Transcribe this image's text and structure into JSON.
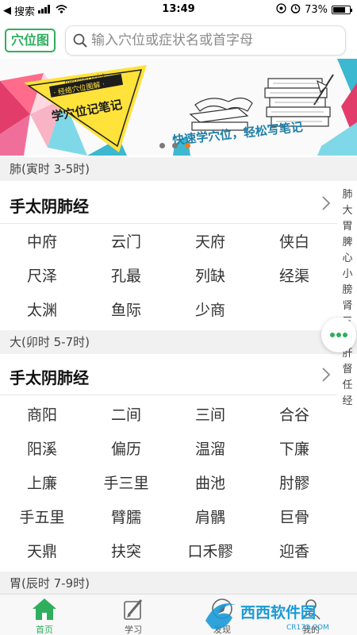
{
  "status_bar": {
    "carrier": "搜索",
    "time": "13:49",
    "battery": "73%"
  },
  "header": {
    "logo_text": "穴位图",
    "search_placeholder": "输入穴位或症状名或首字母"
  },
  "banner": {
    "badge_top": "meridian point",
    "badge_mid": "· 经络穴位图解 ·",
    "badge_title": "学穴位记笔记",
    "slogan": "快速学穴位，轻松写笔记",
    "page_count": 3,
    "active_page": 3,
    "accent_color": "#f0781e"
  },
  "sections": [
    {
      "header": "肺(寅时 3-5时)",
      "meridian": "手太阴肺经",
      "points": [
        "中府",
        "云门",
        "天府",
        "侠白",
        "尺泽",
        "孔最",
        "列缺",
        "经渠",
        "太渊",
        "鱼际",
        "少商"
      ]
    },
    {
      "header": "大(卯时 5-7时)",
      "meridian": "手太阴肺经",
      "points": [
        "商阳",
        "二间",
        "三间",
        "合谷",
        "阳溪",
        "偏历",
        "温溜",
        "下廉",
        "上廉",
        "手三里",
        "曲池",
        "肘髎",
        "手五里",
        "臂臑",
        "肩髃",
        "巨骨",
        "天鼎",
        "扶突",
        "口禾髎",
        "迎香"
      ]
    },
    {
      "header": "胃(辰时 7-9时)"
    }
  ],
  "side_index": [
    "肺",
    "大",
    "胃",
    "脾",
    "心",
    "小",
    "膀",
    "肾",
    "三",
    "胆",
    "肝",
    "督",
    "任",
    "经"
  ],
  "tabs": [
    {
      "label": "首页",
      "icon": "home-icon",
      "active": true
    },
    {
      "label": "学习",
      "icon": "pencil-icon",
      "active": false
    },
    {
      "label": "发现",
      "icon": "discover-icon",
      "active": false
    },
    {
      "label": "我的",
      "icon": "profile-icon",
      "active": false
    }
  ],
  "watermark": {
    "brand": "西西软件园",
    "domain": "CR173.COM"
  },
  "colors": {
    "brand_green": "#2fae5e",
    "section_bg": "#f1f1f1"
  }
}
